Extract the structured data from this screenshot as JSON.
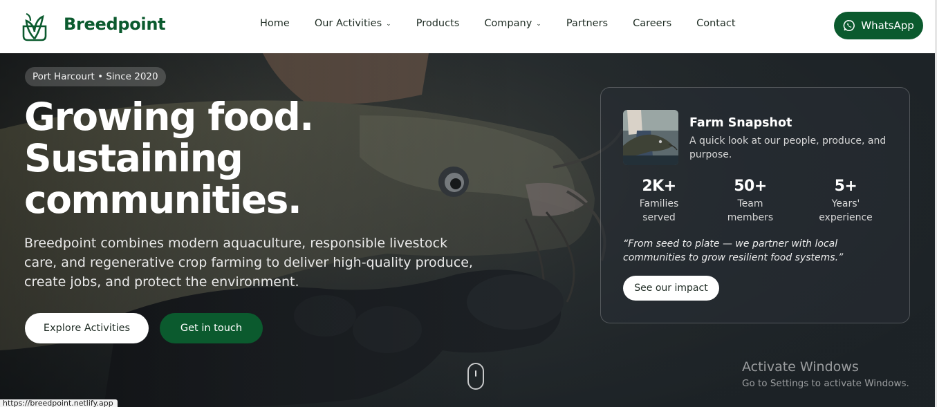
{
  "header": {
    "brand": "Breedpoint",
    "nav": [
      {
        "label": "Home",
        "dropdown": false
      },
      {
        "label": "Our Activities",
        "dropdown": true
      },
      {
        "label": "Products",
        "dropdown": false
      },
      {
        "label": "Company",
        "dropdown": true
      },
      {
        "label": "Partners",
        "dropdown": false
      },
      {
        "label": "Careers",
        "dropdown": false
      },
      {
        "label": "Contact",
        "dropdown": false
      }
    ],
    "whatsapp_label": "WhatsApp"
  },
  "hero": {
    "tag": "Port Harcourt • Since 2020",
    "headline": [
      "Growing food.",
      "Sustaining",
      "communities."
    ],
    "lead": "Breedpoint combines modern aquaculture, responsible livestock care, and regenerative crop farming to deliver high-quality produce, create jobs, and protect the environment.",
    "primary_button": "Explore Activities",
    "secondary_button": "Get in touch"
  },
  "card": {
    "title": "Farm Snapshot",
    "subtitle": "A quick look at our people, produce, and purpose.",
    "stats": [
      {
        "value": "2K+",
        "label": "Families served"
      },
      {
        "value": "50+",
        "label": "Team members"
      },
      {
        "value": "5+",
        "label": "Years' experience"
      }
    ],
    "quote": "“From seed to plate — we partner with local communities to grow resilient food systems.”",
    "button": "See our impact"
  },
  "overlay": {
    "activate_title": "Activate Windows",
    "activate_sub": "Go to Settings to activate Windows."
  },
  "status_url": "https://breedpoint.netlify.app",
  "colors": {
    "brand_green": "#0b5a2e",
    "header_bg": "#ffffff",
    "hero_bg": "#23292c"
  },
  "icons": [
    "leaf-logo-icon",
    "whatsapp-icon",
    "chevron-down-icon",
    "scroll-mouse-icon"
  ]
}
